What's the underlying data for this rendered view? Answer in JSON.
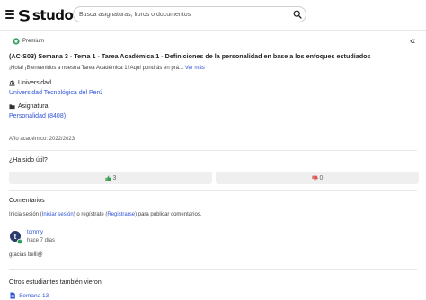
{
  "header": {
    "logo_text": "studocu",
    "search_placeholder": "Busca asignaturas, libros o documentos"
  },
  "document": {
    "badge": "Premium",
    "title": "(AC-S03) Semana 3 - Tema 1 - Tarea Académica 1 - Definiciones de la personalidad en base a los enfoques estudiados",
    "description": "¡Hola! ¡Bienvenidos a nuestra Tarea Académica 1! Aquí pondrás en prá...",
    "more_link": "Ver más",
    "university_label": "Universidad",
    "university": "Universidad Tecnológica del Perú",
    "subject_label": "Asignatura",
    "subject": "Personalidad (8408)",
    "academic_year": "Año académico: 2022/2023"
  },
  "rating": {
    "question": "¿Ha sido útil?",
    "likes": "3",
    "dislikes": "0"
  },
  "comments": {
    "heading": "Comentarios",
    "login_prefix": "Inicia sesión (",
    "login_link": "Iniciar sesión",
    "login_middle": ") o regístrate (",
    "register_link": "Registrarse",
    "login_suffix": ") para publicar comentarios.",
    "items": [
      {
        "user": "tommy",
        "time": "hace 7 días",
        "text": "gracias belli@"
      }
    ]
  },
  "related": {
    "heading": "Otros estudiantes también vieron",
    "items": [
      {
        "label": "Semana 13"
      }
    ]
  },
  "colors": {
    "link": "#2f54d6",
    "badge_green": "#2e9e5b"
  }
}
